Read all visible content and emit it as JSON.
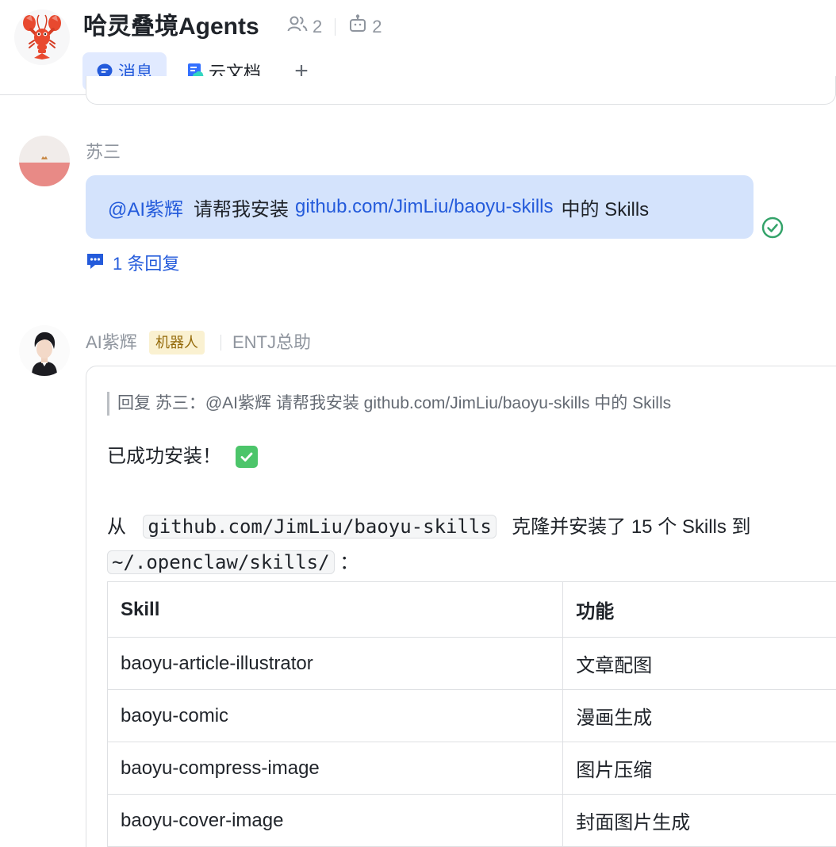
{
  "header": {
    "group_name": "哈灵叠境Agents",
    "member_count": "2",
    "bot_count": "2",
    "tabs": [
      {
        "label": "消息",
        "icon": "chat-bubble-icon",
        "active": true
      },
      {
        "label": "云文档",
        "icon": "doc-icon",
        "active": false
      }
    ],
    "add_tab_label": "+"
  },
  "messages": {
    "user_msg": {
      "sender": "苏三",
      "mention": "@AI紫辉",
      "text_before": "请帮我安装",
      "link": "github.com/JimLiu/baoyu-skills",
      "text_after": "中的 Skills",
      "reply_count": "1 条回复"
    },
    "bot_msg": {
      "sender": "AI紫辉",
      "tag": "机器人",
      "role": "ENTJ总助",
      "quote": "回复 苏三：@AI紫辉 请帮我安装 github.com/JimLiu/baoyu-skills 中的 Skills",
      "success": "已成功安装！",
      "line1_prefix": "从",
      "line1_code": "github.com/JimLiu/baoyu-skills",
      "line1_suffix": "克隆并安装了 15 个 Skills 到",
      "line2_code": "~/.openclaw/skills/",
      "line2_suffix": "：",
      "table": {
        "headers": [
          "Skill",
          "功能"
        ],
        "rows": [
          [
            "baoyu-article-illustrator",
            "文章配图"
          ],
          [
            "baoyu-comic",
            "漫画生成"
          ],
          [
            "baoyu-compress-image",
            "图片压缩"
          ],
          [
            "baoyu-cover-image",
            "封面图片生成"
          ]
        ]
      }
    }
  },
  "colors": {
    "accent": "#245bdb",
    "bubble": "#d4e3fc",
    "active_tab": "#e1eaff",
    "success_green": "#4cc56a"
  }
}
